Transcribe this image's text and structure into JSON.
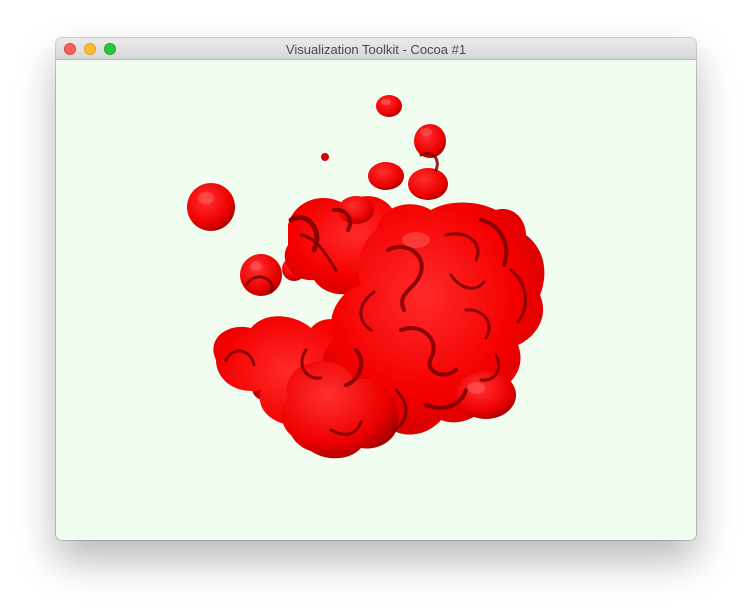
{
  "window": {
    "title": "Visualization Toolkit - Cocoa #1"
  },
  "colors": {
    "background": "#f0fdf0",
    "object": "#ff0000",
    "object_dark": "#8b0000"
  },
  "viewport": {
    "scene": "red translucent blobby isosurface"
  }
}
